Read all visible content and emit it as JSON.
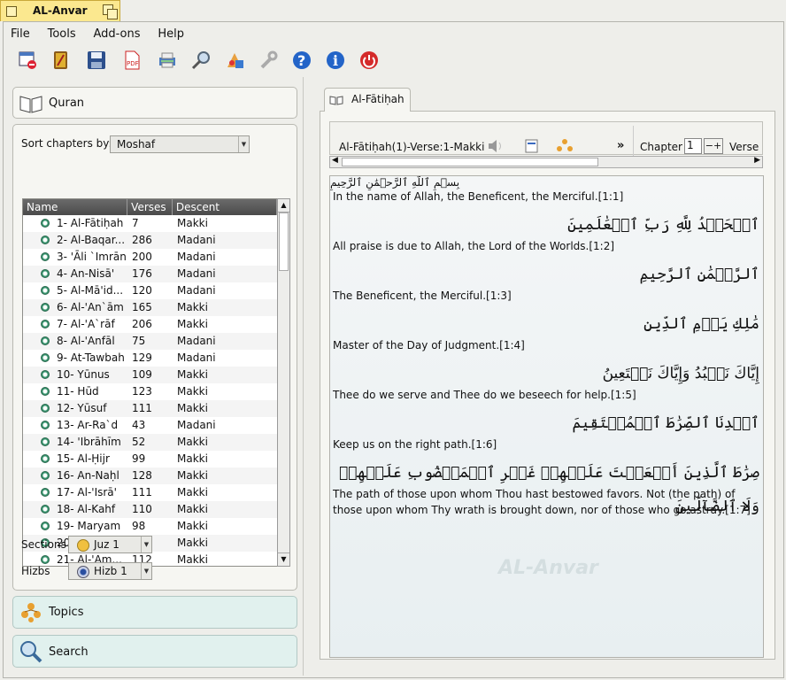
{
  "window": {
    "title": "AL-Anvar"
  },
  "menu": [
    "File",
    "Tools",
    "Add-ons",
    "Help"
  ],
  "toolbar": [
    "new-window-icon",
    "book-icon",
    "save-icon",
    "pdf-icon",
    "print-icon",
    "search-icon",
    "addons-icon",
    "wrench-icon",
    "help-icon",
    "info-icon",
    "power-icon"
  ],
  "left": {
    "quran_label": "Quran",
    "sort_label": "Sort chapters by:",
    "sort_value": "Moshaf",
    "columns": [
      "Name",
      "Verses",
      "Descent"
    ],
    "chapters": [
      [
        "1- Al-Fātiḥah",
        "7",
        "Makki"
      ],
      [
        "2- Al-Baqar...",
        "286",
        "Madani"
      ],
      [
        "3- 'Āli `Imrān",
        "200",
        "Madani"
      ],
      [
        "4- An-Nisā'",
        "176",
        "Madani"
      ],
      [
        "5- Al-Mā'id...",
        "120",
        "Madani"
      ],
      [
        "6- Al-'An`ām",
        "165",
        "Makki"
      ],
      [
        "7- Al-'A`rāf",
        "206",
        "Makki"
      ],
      [
        "8- Al-'Anfāl",
        "75",
        "Madani"
      ],
      [
        "9- At-Tawbah",
        "129",
        "Madani"
      ],
      [
        "10- Yūnus",
        "109",
        "Makki"
      ],
      [
        "11- Hūd",
        "123",
        "Makki"
      ],
      [
        "12- Yūsuf",
        "111",
        "Makki"
      ],
      [
        "13- Ar-Ra`d",
        "43",
        "Madani"
      ],
      [
        "14- 'Ibrāhīm",
        "52",
        "Makki"
      ],
      [
        "15- Al-Ḥijr",
        "99",
        "Makki"
      ],
      [
        "16- An-Naḥl",
        "128",
        "Makki"
      ],
      [
        "17- Al-'Isrā'",
        "111",
        "Makki"
      ],
      [
        "18- Al-Kahf",
        "110",
        "Makki"
      ],
      [
        "19- Maryam",
        "98",
        "Makki"
      ],
      [
        "20- Ṭā-Hā",
        "135",
        "Makki"
      ],
      [
        "21- Al-'Am...",
        "112",
        "Makki"
      ]
    ],
    "sections_label": "Sections",
    "sections_value": "Juz 1",
    "hizbs_label": "Hizbs",
    "hizbs_value": "Hizb 1",
    "topics_label": "Topics",
    "search_label": "Search"
  },
  "right": {
    "tab_label": "Al-Fātiḥah",
    "verse_info": "Al-Fātiḥah(1)-Verse:1-Makki",
    "more": "»",
    "chapter_label": "Chapter",
    "chapter_value": "1",
    "verse_label": "Verse",
    "bismillah": "بِسۡمِ ٱللَّهِ ٱلرَّحۡمَٰنِ ٱلرَّحِيمِ",
    "verses": [
      {
        "ar": "",
        "tr": "In the name of Allah, the Beneficent, the Merciful.[1:1]"
      },
      {
        "ar": "ٱلۡحَمۡدُ لِلَّهِ رَبِّ ٱلۡعَٰلَمِينَ",
        "tr": "All praise is due to Allah, the Lord of the Worlds.[1:2]"
      },
      {
        "ar": "ٱلرَّحۡمَٰنِ ٱلرَّحِيمِ",
        "tr": "The Beneficent, the Merciful.[1:3]"
      },
      {
        "ar": "مَٰلِكِ يَوۡمِ ٱلدِّينِ",
        "tr": "Master of the Day of Judgment.[1:4]"
      },
      {
        "ar": "إِيَّاكَ نَعۡبُدُ وَإِيَّاكَ نَسۡتَعِينُ",
        "tr": "Thee do we serve and Thee do we beseech for help.[1:5]"
      },
      {
        "ar": "ٱهۡدِنَا ٱلصِّرَٰطَ ٱلۡمُسۡتَقِيمَ",
        "tr": "Keep us on the right path.[1:6]"
      },
      {
        "ar": "صِرَٰطَ ٱلَّذِينَ أَنۡعَمۡتَ عَلَيۡهِمۡ غَيۡرِ ٱلۡمَغۡضُوبِ عَلَيۡهِمۡ وَلَا ٱلضَّآلِّينَ",
        "tr": "The path of those upon whom Thou hast bestowed favors. Not (the path) of those upon whom Thy wrath is brought down, nor of those who go astray.[1:7]"
      }
    ],
    "watermark": "AL-Anvar"
  }
}
